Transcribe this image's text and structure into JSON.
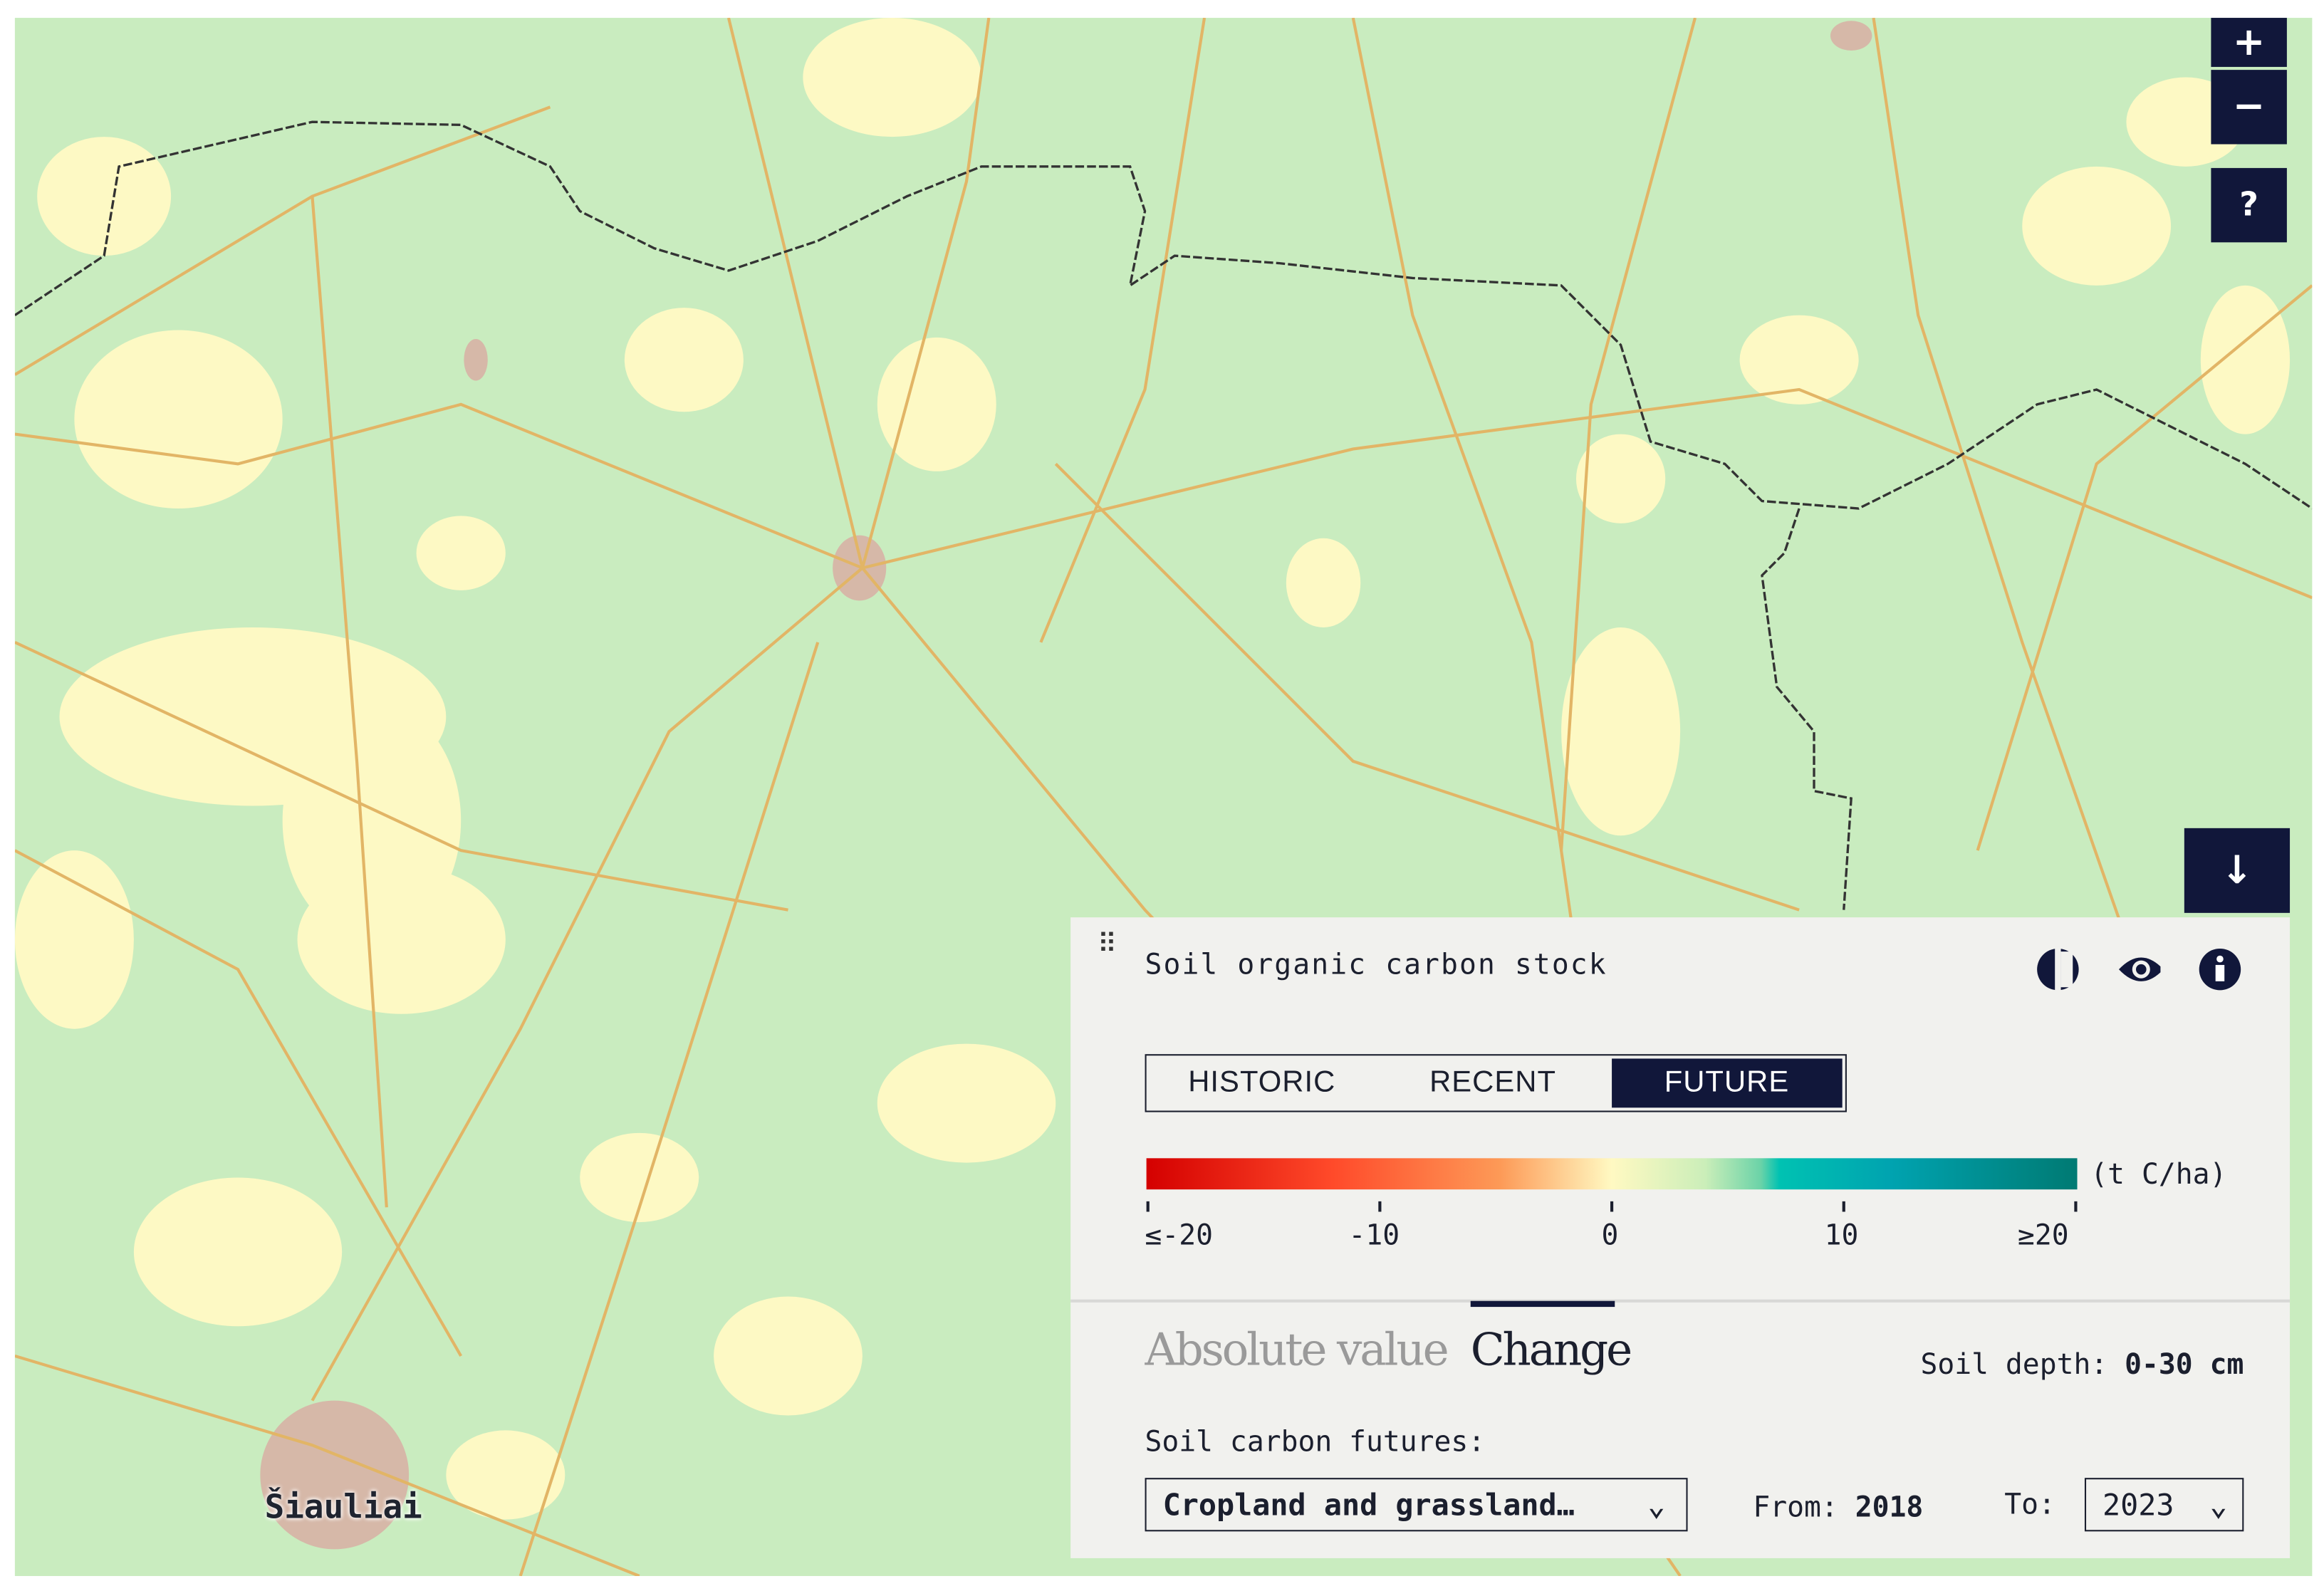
{
  "map": {
    "city_label": "Šiauliai",
    "colors": {
      "land": "#c9ecbf",
      "low": "#fdf9c4",
      "road": "#e2b566",
      "border": "#333333"
    }
  },
  "controls": {
    "zoom_in": "+",
    "zoom_out": "−",
    "help": "?",
    "collapse": "↓"
  },
  "panel": {
    "title": "Soil organic carbon stock",
    "icons": [
      "compare-icon",
      "eye-icon",
      "info-icon"
    ],
    "periods": [
      "HISTORIC",
      "RECENT",
      "FUTURE"
    ],
    "active_period": "FUTURE",
    "legend": {
      "unit": "(t C/ha)",
      "ticks": [
        "≤-20",
        "-10",
        "0",
        "10",
        "≥20"
      ]
    },
    "tabs": [
      "Absolute value",
      "Change"
    ],
    "active_tab": "Change",
    "soil_depth_label": "Soil depth:",
    "soil_depth_value": "0-30 cm",
    "futures_label": "Soil carbon futures:",
    "futures_value": "Cropland and grassland…",
    "from_label": "From:",
    "from_value": "2018",
    "to_label": "To:",
    "to_value": "2023"
  }
}
